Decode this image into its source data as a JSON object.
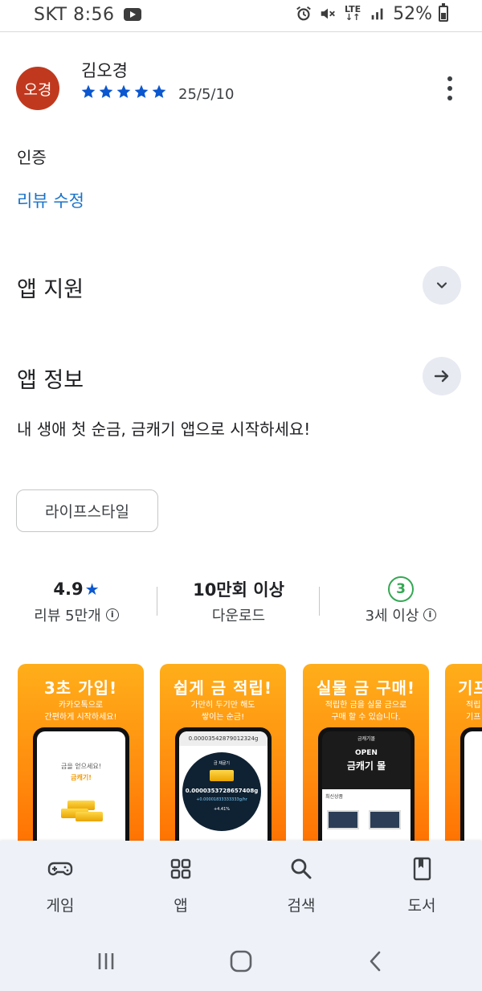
{
  "status_bar": {
    "carrier_time": "SKT 8:56",
    "network": "LTE",
    "battery": "52%",
    "icons": [
      "youtube-icon",
      "alarm-icon",
      "mute-icon",
      "lte-icon",
      "signal-icon",
      "battery-icon"
    ]
  },
  "review": {
    "avatar_text": "오경",
    "avatar_color": "#c0391f",
    "reviewer_name": "김오경",
    "rating": 5,
    "date": "25/5/10",
    "text": "인증",
    "edit_label": "리뷰 수정"
  },
  "sections": {
    "app_support": "앱 지원",
    "app_info": "앱 정보"
  },
  "app_description": "내 생애 첫 순금, 금캐기 앱으로 시작하세요!",
  "category_chip": "라이프스타일",
  "stats": {
    "rating_value": "4.9",
    "rating_label": "리뷰 5만개",
    "downloads_value": "10만회 이상",
    "downloads_label": "다운로드",
    "age_value": "3",
    "age_label": "3세 이상"
  },
  "screenshots": [
    {
      "title": "3초 가입!",
      "subtitle": "카카오톡으로\n간편하게 시작하세요!",
      "screen_line1": "금을 얻으세요!",
      "screen_line2": "금캐기!"
    },
    {
      "title": "쉽게 금 적립!",
      "subtitle": "가만히 두기만 해도\n쌓이는 순금!",
      "screen_top": "0.00003542879012324g",
      "circle_label": "금 채굴기",
      "amount": "0.0000353728657408g",
      "rate": "+0.00001833333333g/hr",
      "change": "+4.41%"
    },
    {
      "title": "실물 금 구매!",
      "subtitle": "적립한 금을 실물 금으로\n구매 할 수 있습니다.",
      "screen_top": "금캐기몰",
      "open_label": "OPEN",
      "mall_label": "금캐기 몰",
      "panel_label": "최신상품"
    },
    {
      "title": "기프",
      "subtitle": "적립\n기프"
    }
  ],
  "bottom_nav": [
    {
      "label": "게임",
      "icon": "gamepad-icon"
    },
    {
      "label": "앱",
      "icon": "apps-grid-icon"
    },
    {
      "label": "검색",
      "icon": "search-icon"
    },
    {
      "label": "도서",
      "icon": "book-icon"
    }
  ],
  "system_nav": [
    "recent-apps-icon",
    "home-icon",
    "back-icon"
  ],
  "colors": {
    "link_blue": "#1a73c8",
    "star_blue": "#0b57d0",
    "age_green": "#34a853",
    "screenshot_orange": "#ff8a0d",
    "nav_background": "#eef1f8"
  }
}
